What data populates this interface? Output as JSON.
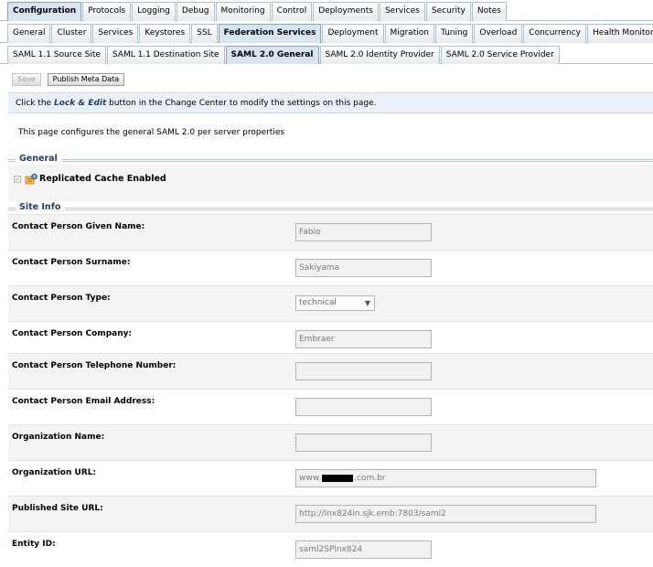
{
  "tabs_row1": [
    "Configuration",
    "Protocols",
    "Logging",
    "Debug",
    "Monitoring",
    "Control",
    "Deployments",
    "Services",
    "Security",
    "Notes"
  ],
  "tabs_row2": [
    "General",
    "Cluster",
    "Services",
    "Keystores",
    "SSL",
    "Federation Services",
    "Deployment",
    "Migration",
    "Tuning",
    "Overload",
    "Concurrency",
    "Health Monitoring"
  ],
  "tabs_row3": [
    "SAML 1.1 Source Site",
    "SAML 1.1 Destination Site",
    "SAML 2.0 General",
    "SAML 2.0 Identity Provider",
    "SAML 2.0 Service Provider"
  ],
  "toolbar": {
    "save_label": "Save",
    "publish_label": "Publish Meta Data"
  },
  "info": {
    "before": "Click the ",
    "emphasis": "Lock & Edit",
    "after": " button in the Change Center to modify the settings on this page."
  },
  "description": "This page configures the general SAML 2.0 per server properties",
  "general": {
    "title": "General",
    "replicated_cache_label": "Replicated Cache Enabled",
    "replicated_cache_checked": true
  },
  "site_info": {
    "title": "Site Info",
    "given_name": {
      "label": "Contact Person Given Name:",
      "value": "Fabio"
    },
    "surname": {
      "label": "Contact Person Surname:",
      "value": "Sakiyama"
    },
    "type": {
      "label": "Contact Person Type:",
      "value": "technical"
    },
    "company": {
      "label": "Contact Person Company:",
      "value": "Embraer"
    },
    "telephone": {
      "label": "Contact Person Telephone Number:",
      "value": ""
    },
    "email": {
      "label": "Contact Person Email Address:",
      "value": ""
    },
    "org_name": {
      "label": "Organization Name:",
      "value": ""
    },
    "org_url": {
      "label": "Organization URL:",
      "value_prefix": "www.",
      "value_suffix": ".com.br"
    },
    "published_url": {
      "label": "Published Site URL:",
      "value": "http://lnx824in.sjk.emb:7803/saml2"
    },
    "entity_id": {
      "label": "Entity ID:",
      "value": "saml2SPlnx824"
    }
  }
}
